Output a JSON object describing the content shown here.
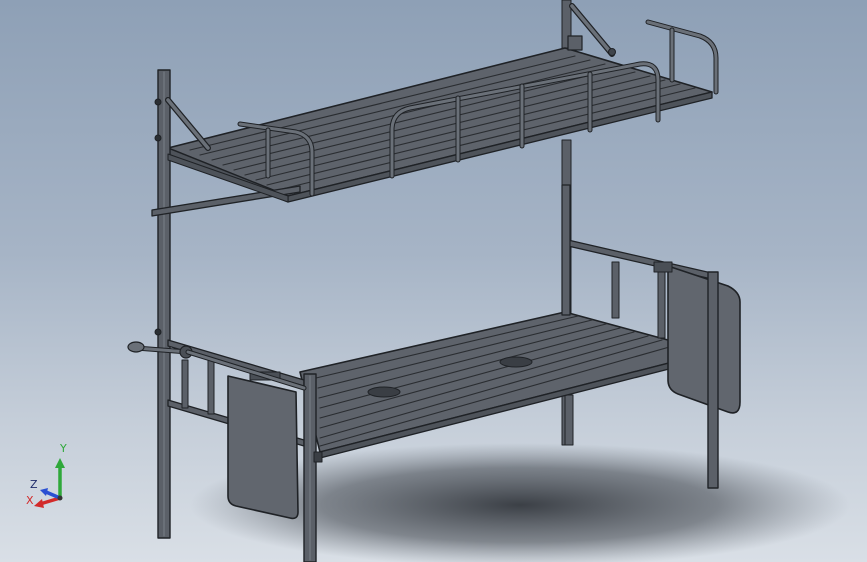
{
  "viewport": {
    "background_top": "#8ea0b6",
    "background_bottom": "#d9dfe6",
    "model_color": "#5b6068",
    "edge_color": "#1f2226",
    "panel_color": "#61666e"
  },
  "triad": {
    "x_label": "X",
    "y_label": "Y",
    "z_label": "Z",
    "x_color": "#d22a2a",
    "y_color": "#2fa83a",
    "z_color": "#2a4fd2"
  }
}
